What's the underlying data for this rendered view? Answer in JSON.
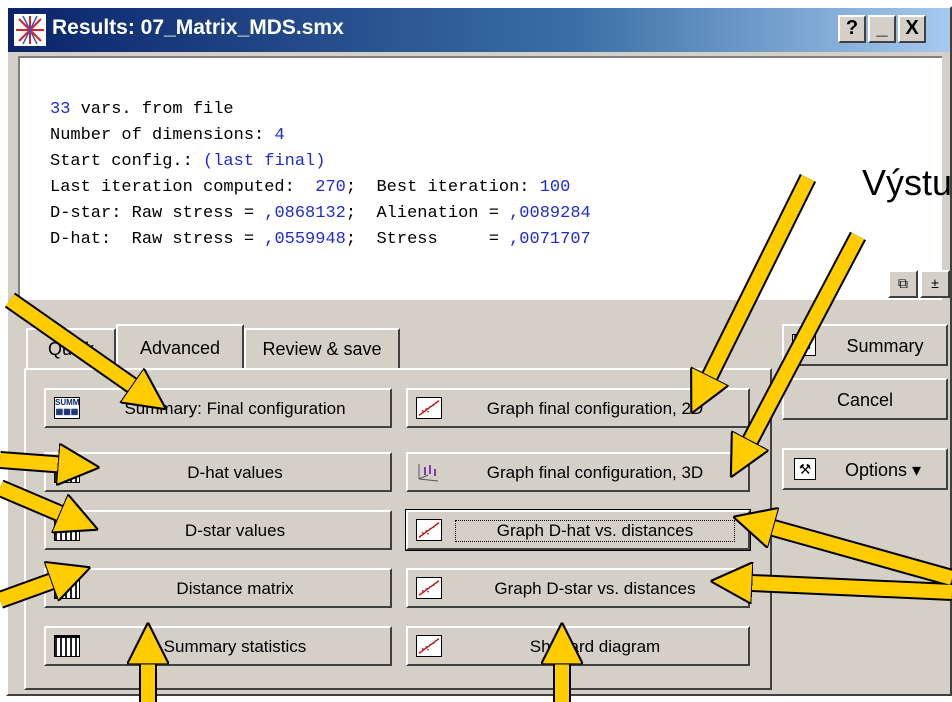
{
  "window": {
    "title": "Results: 07_Matrix_MDS.smx",
    "help_btn": "?",
    "min_btn": "_",
    "close_btn": "X"
  },
  "output": {
    "lines": [
      {
        "a": "",
        "v": "33",
        "b": " vars. from file"
      },
      {
        "a": "Number of dimensions: ",
        "v": "4",
        "b": ""
      },
      {
        "a": "Start config.: ",
        "v": "(last final)",
        "b": ""
      },
      {
        "a": "Last iteration computed:  ",
        "v": "270",
        "b": ";  Best iteration: ",
        "v2": "100"
      },
      {
        "a": "D-star: Raw stress = ",
        "v": ",0868132",
        "b": ";  Alienation = ",
        "v2": ",0089284"
      },
      {
        "a": "D-hat:  Raw stress = ",
        "v": ",0559948",
        "b": ";  Stress     = ",
        "v2": ",0071707"
      }
    ]
  },
  "overlay_label": "Výstu",
  "tabs": {
    "quick": "Quick",
    "advanced": "Advanced",
    "review": "Review & save"
  },
  "buttons_left": [
    "Summary: Final configuration",
    "D-hat values",
    "D-star values",
    "Distance matrix",
    "Summary statistics"
  ],
  "buttons_right": [
    "Graph final configuration, 2D",
    "Graph final configuration, 3D",
    "Graph D-hat vs. distances",
    "Graph D-star vs. distances",
    "Shepard diagram"
  ],
  "side_buttons": {
    "summary": "Summary",
    "cancel": "Cancel",
    "options": "Options ▾"
  },
  "colors": {
    "titlebar": "#0a246a",
    "value_text": "#1f2bd6",
    "arrow_fill": "#ffcc00"
  }
}
